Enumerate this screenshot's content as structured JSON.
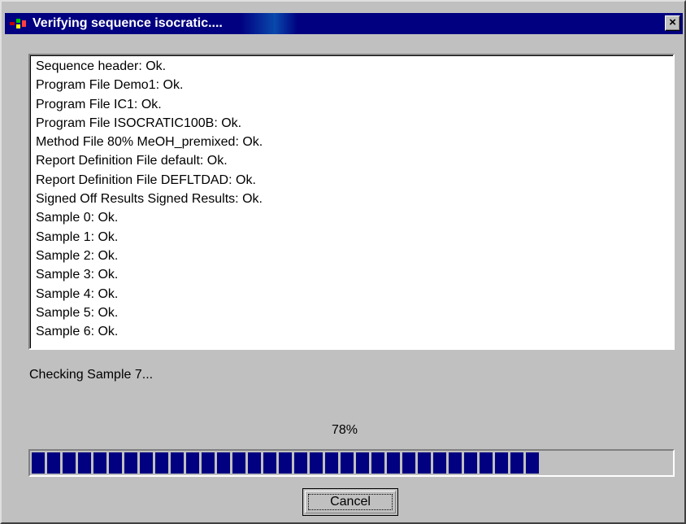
{
  "window": {
    "title": "Verifying sequence isocratic....",
    "close_label": "×"
  },
  "log": {
    "lines": [
      "Sequence header: Ok.",
      "Program File Demo1: Ok.",
      "Program File IC1: Ok.",
      "Program File ISOCRATIC100B: Ok.",
      "Method File 80% MeOH_premixed: Ok.",
      "Report Definition File default: Ok.",
      "Report Definition File DEFLTDAD: Ok.",
      "Signed Off Results Signed Results: Ok.",
      "Sample 0: Ok.",
      "Sample 1: Ok.",
      "Sample 2: Ok.",
      "Sample 3: Ok.",
      "Sample 4: Ok.",
      "Sample 5: Ok.",
      "Sample 6: Ok."
    ]
  },
  "status": {
    "text": "Checking Sample 7..."
  },
  "progress": {
    "label": "78%",
    "value": 0.78,
    "bar_color": "#000080"
  },
  "buttons": {
    "cancel_label": "Cancel"
  },
  "colors": {
    "titlebar": "#000080",
    "face": "#c0c0c0"
  },
  "icons": {
    "app": "app-icon",
    "close": "close-icon"
  }
}
